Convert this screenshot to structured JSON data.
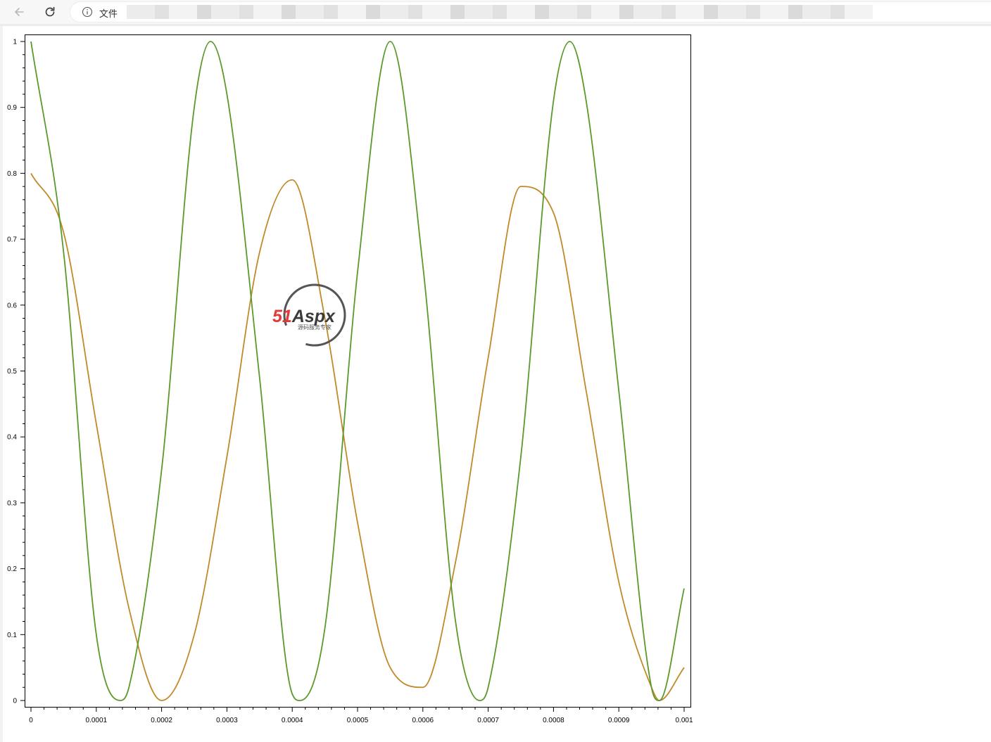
{
  "browser": {
    "scheme_label": "文件",
    "icons": {
      "back": "arrow-left-icon",
      "reload": "reload-icon",
      "info": "info-icon"
    }
  },
  "watermark": {
    "brand_digits": "51",
    "brand_name": "Aspx",
    "tagline": "源码服务专家",
    "colors": {
      "digits": "#e03a3a",
      "name": "#3b3b3b",
      "x": "#3aaa35",
      "ring": "#555555"
    }
  },
  "chart_data": {
    "type": "line",
    "title": "",
    "xlabel": "",
    "ylabel": "",
    "xlim": [
      0,
      0.001
    ],
    "ylim": [
      0,
      1
    ],
    "grid": false,
    "legend": "none",
    "x_ticks": [
      0,
      0.0001,
      0.0002,
      0.0003,
      0.0004,
      0.0005,
      0.0006,
      0.0007,
      0.0008,
      0.0009,
      0.001
    ],
    "x_tick_labels": [
      "0",
      "0.0001",
      "0.0002",
      "0.0003",
      "0.0004",
      "0.0005",
      "0.0006",
      "0.0007",
      "0.0008",
      "0.0009",
      "0.001"
    ],
    "y_ticks": [
      0,
      0.1,
      0.2,
      0.3,
      0.4,
      0.5,
      0.6,
      0.7,
      0.8,
      0.9,
      1
    ],
    "y_tick_labels": [
      "0",
      "0.1",
      "0.2",
      "0.3",
      "0.4",
      "0.5",
      "0.6",
      "0.7",
      "0.8",
      "0.9",
      "1"
    ],
    "series": [
      {
        "color": "#5a9a2a",
        "x": [
          0,
          5e-05,
          0.0001,
          0.000137,
          0.00015,
          0.0002,
          0.00025,
          0.000275,
          0.0003,
          0.00035,
          0.0004,
          0.000412,
          0.00045,
          0.0005,
          0.00055,
          0.0006,
          0.00065,
          0.000687,
          0.0007,
          0.00075,
          0.0008,
          0.000825,
          0.00085,
          0.0009,
          0.00095,
          0.000962,
          0.001
        ],
        "y": [
          1,
          0.68,
          0.1,
          0,
          0.02,
          0.35,
          0.9,
          1,
          0.92,
          0.49,
          0.01,
          0,
          0.11,
          0.65,
          1,
          0.66,
          0.12,
          0,
          0.02,
          0.37,
          0.91,
          1,
          0.91,
          0.47,
          0.02,
          0,
          0.17
        ]
      },
      {
        "color": "#c08a2a",
        "x": [
          0,
          5e-05,
          0.0001,
          0.00015,
          0.0002,
          0.00025,
          0.0003,
          0.00035,
          0.0004,
          0.00045,
          0.0005,
          0.00055,
          0.0006,
          0.00065,
          0.0007,
          0.00075,
          0.0008,
          0.00085,
          0.0009,
          0.00095,
          0.000962,
          0.001
        ],
        "y": [
          0.8,
          0.71,
          0.42,
          0.14,
          0,
          0.1,
          0.37,
          0.68,
          0.79,
          0.58,
          0.27,
          0.05,
          0.02,
          0.21,
          0.52,
          0.78,
          0.74,
          0.47,
          0.18,
          0.02,
          0,
          0.05
        ]
      }
    ]
  }
}
